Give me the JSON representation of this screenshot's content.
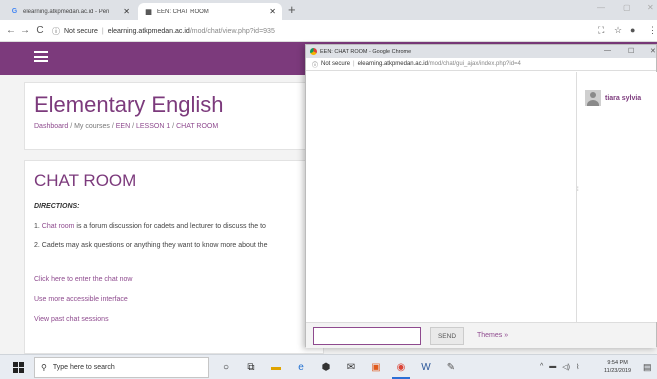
{
  "browser": {
    "tabs": [
      {
        "title": "elearning.atkpmedan.ac.id - Pen",
        "favicon": "G",
        "favicon_color": "#4285f4",
        "active": false
      },
      {
        "title": "EEN: CHAT ROOM",
        "favicon": "▦",
        "favicon_color": "#555555",
        "active": true
      }
    ],
    "new_tab_label": "+",
    "window_controls": {
      "minimize": "—",
      "maximize": "▢",
      "close": "✕"
    },
    "nav": {
      "back": "←",
      "forward": "→",
      "reload": "C"
    },
    "address": {
      "security_label": "Not secure",
      "host": "elearning.atkpmedan.ac.id",
      "path": "/mod/chat/view.php?id=935"
    },
    "toolbar_icons": [
      "translate-icon",
      "star-icon",
      "account-icon",
      "menu-icon"
    ]
  },
  "moodle": {
    "course_title": "Elementary English",
    "breadcrumb": [
      "Dashboard",
      "My courses",
      "EEN",
      "LESSON 1",
      "CHAT ROOM"
    ],
    "breadcrumb_separator": " / ",
    "activity_title": "CHAT ROOM",
    "directions_label": "DIRECTIONS:",
    "para1_prefix": "1. ",
    "para1_link": "Chat room",
    "para1_rest": " is a forum discussion for cadets and lecturer to discuss the to",
    "para2": "2. Cadets may ask questions or anything they want to know more about the",
    "links": {
      "enter_chat": "Click here to enter the chat now",
      "accessible": "Use more accessible interface",
      "past_sessions": "View past chat sessions"
    }
  },
  "popup": {
    "title": "EEN: CHAT ROOM - Google Chrome",
    "window_controls": {
      "minimize": "—",
      "maximize": "☐",
      "close": "✕"
    },
    "address": {
      "security_label": "Not secure",
      "host": "elearning.atkpmedan.ac.id",
      "path": "/mod/chat/gui_ajax/index.php?id=4"
    },
    "user_name": "tiara sylvia",
    "input_value": "",
    "send_label": "SEND",
    "themes_label": "Themes »"
  },
  "taskbar": {
    "search_placeholder": "Type here to search",
    "time": "9:54 PM",
    "date": "11/23/2019",
    "apps": [
      {
        "name": "cortana-icon",
        "glyph": "○",
        "color": "#222222"
      },
      {
        "name": "task-view-icon",
        "glyph": "⧉",
        "color": "#222222"
      },
      {
        "name": "file-explorer-icon",
        "glyph": "▬",
        "color": "#e0a400"
      },
      {
        "name": "edge-icon",
        "glyph": "e",
        "color": "#1f6fd0"
      },
      {
        "name": "store-icon",
        "glyph": "⬢",
        "color": "#333333"
      },
      {
        "name": "mail-icon",
        "glyph": "✉",
        "color": "#333333"
      },
      {
        "name": "media-icon",
        "glyph": "▣",
        "color": "#e05a1c"
      },
      {
        "name": "chrome-icon",
        "glyph": "◉",
        "color": "#db4437",
        "active": true
      },
      {
        "name": "word-icon",
        "glyph": "W",
        "color": "#2b579a"
      },
      {
        "name": "paint-icon",
        "glyph": "✎",
        "color": "#555555"
      }
    ]
  },
  "colors": {
    "brand": "#7c3a7c",
    "link": "#8e4a8e"
  }
}
